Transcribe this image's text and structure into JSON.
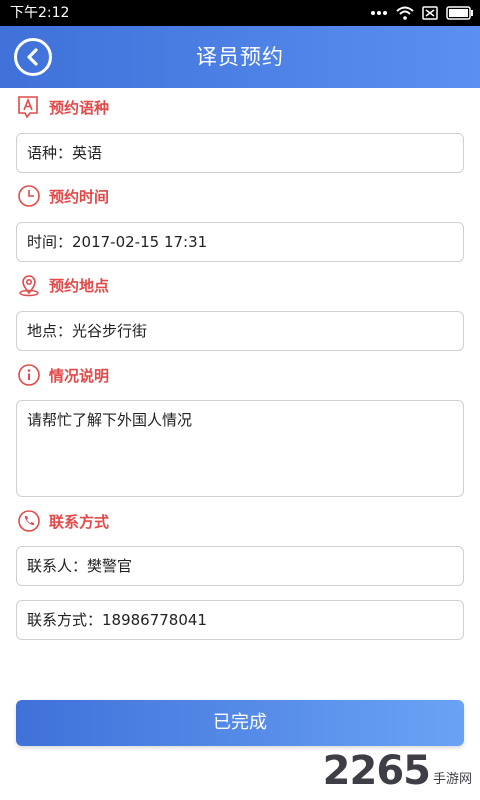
{
  "status_bar": {
    "time": "下午2:12"
  },
  "header": {
    "title": "译员预约"
  },
  "sections": {
    "language": {
      "label": "预约语种",
      "field": "语种：英语"
    },
    "time": {
      "label": "预约时间",
      "field": "时间：2017-02-15 17:31"
    },
    "location": {
      "label": "预约地点",
      "field": "地点：光谷步行街"
    },
    "description": {
      "label": "情况说明",
      "field": "请帮忙了解下外国人情况"
    },
    "contact": {
      "label": "联系方式",
      "person": "联系人：樊警官",
      "phone": "联系方式：18986778041"
    }
  },
  "footer": {
    "button_label": "已完成"
  },
  "watermark": {
    "number": "2265",
    "text": "手游网"
  },
  "colors": {
    "accent_blue": "#3f71d9",
    "section_red": "#e24a4a"
  },
  "icons": [
    "back-icon",
    "language-icon",
    "clock-icon",
    "location-icon",
    "info-icon",
    "phone-icon",
    "wifi-icon",
    "battery-icon"
  ]
}
